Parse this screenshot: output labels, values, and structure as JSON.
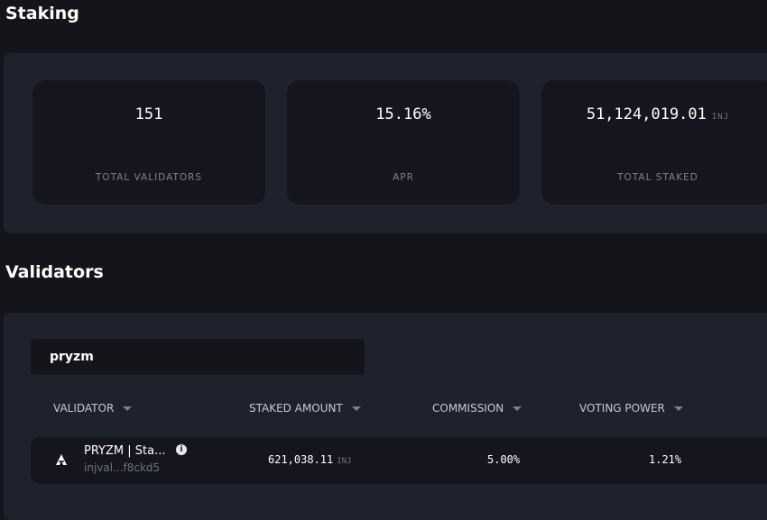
{
  "staking": {
    "title": "Staking",
    "stats": [
      {
        "value": "151",
        "label": "TOTAL VALIDATORS",
        "unit": ""
      },
      {
        "value": "15.16%",
        "label": "APR",
        "unit": ""
      },
      {
        "value": "51,124,019.01",
        "label": "TOTAL STAKED",
        "unit": "INJ"
      }
    ]
  },
  "validators": {
    "title": "Validators",
    "search_value": "pryzm",
    "columns": [
      "VALIDATOR",
      "STAKED AMOUNT",
      "COMMISSION",
      "VOTING POWER"
    ],
    "rows": [
      {
        "name": "PRYZM | Sta...",
        "address": "injval...f8ckd5",
        "staked": "621,038.11",
        "staked_unit": "INJ",
        "commission": "5.00%",
        "voting_power": "1.21%",
        "logo_icon": "pryzm-logo-icon",
        "info_icon": "info-icon"
      }
    ]
  },
  "colors": {
    "background": "#14151b",
    "panel": "#1f222c",
    "card": "#15161d",
    "muted_text": "#7c8090"
  }
}
